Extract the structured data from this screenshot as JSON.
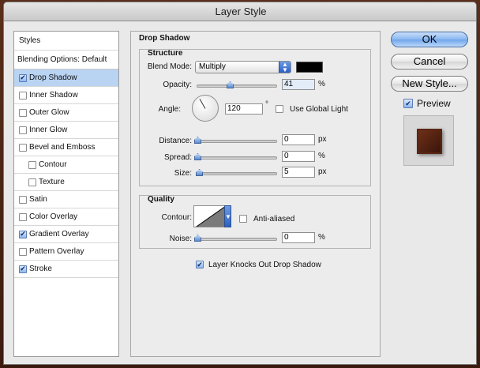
{
  "window": {
    "title": "Layer Style"
  },
  "styles_list": {
    "header": "Styles",
    "blending": "Blending Options: Default",
    "items": [
      {
        "label": "Drop Shadow",
        "checked": true,
        "selected": true,
        "indent": false
      },
      {
        "label": "Inner Shadow",
        "checked": false,
        "selected": false,
        "indent": false
      },
      {
        "label": "Outer Glow",
        "checked": false,
        "selected": false,
        "indent": false
      },
      {
        "label": "Inner Glow",
        "checked": false,
        "selected": false,
        "indent": false
      },
      {
        "label": "Bevel and Emboss",
        "checked": false,
        "selected": false,
        "indent": false
      },
      {
        "label": "Contour",
        "checked": false,
        "selected": false,
        "indent": true
      },
      {
        "label": "Texture",
        "checked": false,
        "selected": false,
        "indent": true
      },
      {
        "label": "Satin",
        "checked": false,
        "selected": false,
        "indent": false
      },
      {
        "label": "Color Overlay",
        "checked": false,
        "selected": false,
        "indent": false
      },
      {
        "label": "Gradient Overlay",
        "checked": true,
        "selected": false,
        "indent": false
      },
      {
        "label": "Pattern Overlay",
        "checked": false,
        "selected": false,
        "indent": false
      },
      {
        "label": "Stroke",
        "checked": true,
        "selected": false,
        "indent": false
      }
    ]
  },
  "drop_shadow": {
    "title": "Drop Shadow",
    "structure": {
      "title": "Structure",
      "blend_mode_label": "Blend Mode:",
      "blend_mode_value": "Multiply",
      "shadow_color": "#000000",
      "opacity_label": "Opacity:",
      "opacity_value": "41",
      "opacity_unit": "%",
      "opacity_fraction": 0.41,
      "angle_label": "Angle:",
      "angle_value": "120",
      "angle_degrees": 120,
      "angle_unit": "°",
      "global_light_label": "Use Global Light",
      "global_light_checked": false,
      "distance_label": "Distance:",
      "distance_value": "0",
      "distance_unit": "px",
      "distance_fraction": 0,
      "spread_label": "Spread:",
      "spread_value": "0",
      "spread_unit": "%",
      "spread_fraction": 0,
      "size_label": "Size:",
      "size_value": "5",
      "size_unit": "px",
      "size_fraction": 0.02
    },
    "quality": {
      "title": "Quality",
      "contour_label": "Contour:",
      "anti_aliased_label": "Anti-aliased",
      "anti_aliased_checked": false,
      "noise_label": "Noise:",
      "noise_value": "0",
      "noise_unit": "%",
      "noise_fraction": 0
    },
    "knockout_label": "Layer Knocks Out Drop Shadow",
    "knockout_checked": true
  },
  "buttons": {
    "ok": "OK",
    "cancel": "Cancel",
    "new_style": "New Style...",
    "preview_label": "Preview",
    "preview_checked": true
  },
  "check_glyph": "✔"
}
